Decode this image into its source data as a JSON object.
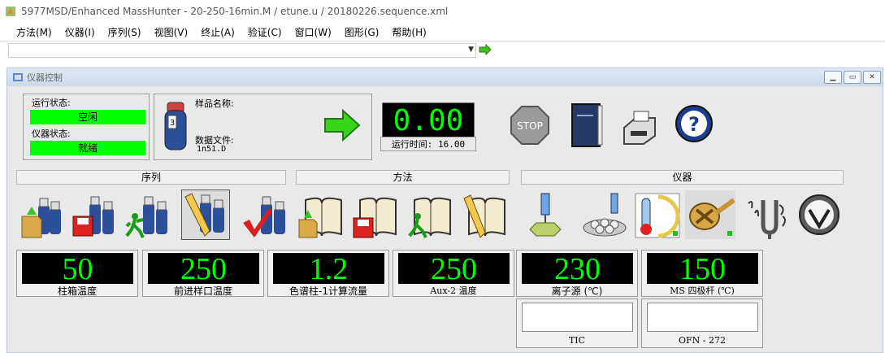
{
  "window": {
    "title": "5977MSD/Enhanced MassHunter - 20-250-16min.M / etune.u / 20180226.sequence.xml"
  },
  "menu": [
    "方法(M)",
    "仪器(I)",
    "序列(S)",
    "视图(V)",
    "终止(A)",
    "验证(C)",
    "窗口(W)",
    "图形(G)",
    "帮助(H)"
  ],
  "mdi": {
    "title": "仪器控制"
  },
  "status": {
    "run_label": "运行状态:",
    "run_value": "空闲",
    "instr_label": "仪器状态:",
    "instr_value": "就绪"
  },
  "sample": {
    "name_label": "样品名称:",
    "name_value": "",
    "file_label": "数据文件:",
    "file_value": "1n51.D",
    "vial_num": "3"
  },
  "run": {
    "display": "0.00",
    "time_label": "运行时间: 16.00"
  },
  "sections": {
    "sequence": "序列",
    "method": "方法",
    "instrument": "仪器"
  },
  "icons": {
    "stop": "STOP",
    "help": "?"
  },
  "gauges": [
    {
      "value": "50",
      "label": "柱箱温度"
    },
    {
      "value": "250",
      "label": "前进样口温度"
    },
    {
      "value": "1.2",
      "label": "色谱柱-1计算流量"
    },
    {
      "value": "250",
      "label": "Aux-2 温度"
    },
    {
      "value": "230",
      "label": "离子源 (℃)"
    },
    {
      "value": "150",
      "label": "MS 四极杆 (℃)"
    }
  ],
  "plots": [
    {
      "label": "TIC"
    },
    {
      "label": "OFN - 272"
    }
  ],
  "colors": {
    "lcd_green": "#00ff00",
    "status_green": "#00ff00"
  }
}
